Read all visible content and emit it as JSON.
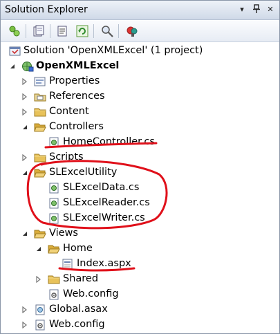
{
  "window": {
    "title": "Solution Explorer",
    "controls": {
      "dropdown": "▾",
      "pin": "⊥",
      "close": "✕"
    }
  },
  "toolbar": {
    "buttons": [
      "properties-icon",
      "show-all-files-icon",
      "refresh-icon",
      "view-code-icon",
      "view-designer-icon",
      "class-diagram-icon"
    ]
  },
  "tree": {
    "solution": "Solution 'OpenXMLExcel' (1 project)",
    "project": "OpenXMLExcel",
    "properties": "Properties",
    "references": "References",
    "content": "Content",
    "controllers": "Controllers",
    "home_controller": "HomeController.cs",
    "scripts": "Scripts",
    "slexcelutility": "SLExcelUtility",
    "slexceldata": "SLExcelData.cs",
    "slexcelreader": "SLExcelReader.cs",
    "slexcelwriter": "SLExcelWriter.cs",
    "views": "Views",
    "home": "Home",
    "index": "Index.aspx",
    "shared": "Shared",
    "views_webconfig": "Web.config",
    "global": "Global.asax",
    "webconfig": "Web.config"
  },
  "colors": {
    "folder": "#e8c25a",
    "annotation": "#e0101a",
    "titlebar": "#cfd9e8"
  }
}
